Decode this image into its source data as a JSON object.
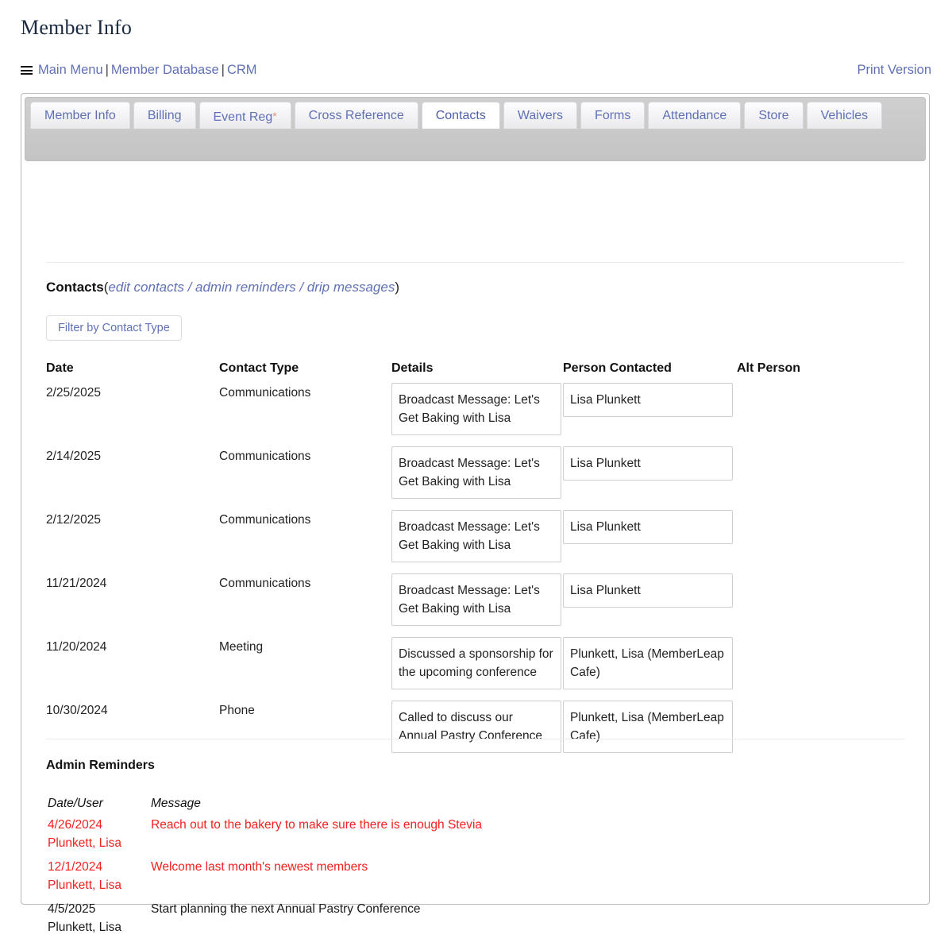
{
  "page": {
    "title": "Member Info"
  },
  "breadcrumb": {
    "menu_icon": "hamburger-icon",
    "items": [
      "Main Menu",
      "Member Database",
      "CRM"
    ],
    "separator": "|"
  },
  "header": {
    "print_link": "Print Version"
  },
  "tabs": [
    {
      "label": "Member Info",
      "active": false,
      "required_marker": ""
    },
    {
      "label": "Billing",
      "active": false,
      "required_marker": ""
    },
    {
      "label": "Event Reg",
      "active": false,
      "required_marker": "*"
    },
    {
      "label": "Cross Reference",
      "active": false,
      "required_marker": ""
    },
    {
      "label": "Contacts",
      "active": true,
      "required_marker": ""
    },
    {
      "label": "Waivers",
      "active": false,
      "required_marker": ""
    },
    {
      "label": "Forms",
      "active": false,
      "required_marker": ""
    },
    {
      "label": "Attendance",
      "active": false,
      "required_marker": ""
    },
    {
      "label": "Store",
      "active": false,
      "required_marker": ""
    },
    {
      "label": "Vehicles",
      "active": false,
      "required_marker": ""
    }
  ],
  "contacts_section": {
    "heading": "Contacts",
    "paren_open": "(",
    "paren_close": ")",
    "sublinks": "edit contacts / admin reminders / drip messages",
    "filter_button": "Filter by Contact Type",
    "columns": [
      "Date",
      "Contact Type",
      "Details",
      "Person Contacted",
      "Alt Person"
    ],
    "rows": [
      {
        "date": "2/25/2025",
        "type": "Communications",
        "details": "Broadcast Message: Let's Get Baking with Lisa",
        "person": "Lisa Plunkett",
        "alt": ""
      },
      {
        "date": "2/14/2025",
        "type": "Communications",
        "details": "Broadcast Message: Let's Get Baking with Lisa",
        "person": "Lisa Plunkett",
        "alt": ""
      },
      {
        "date": "2/12/2025",
        "type": "Communications",
        "details": "Broadcast Message: Let's Get Baking with Lisa",
        "person": "Lisa Plunkett",
        "alt": ""
      },
      {
        "date": "11/21/2024",
        "type": "Communications",
        "details": "Broadcast Message: Let's Get Baking with Lisa",
        "person": "Lisa Plunkett",
        "alt": ""
      },
      {
        "date": "11/20/2024",
        "type": "Meeting",
        "details": "Discussed a sponsorship for the upcoming conference",
        "person": "Plunkett, Lisa (MemberLeap Cafe)",
        "alt": ""
      },
      {
        "date": "10/30/2024",
        "type": "Phone",
        "details": "Called to discuss our Annual Pastry Conference",
        "person": "Plunkett, Lisa (MemberLeap Cafe)",
        "alt": ""
      }
    ]
  },
  "reminders_section": {
    "heading": "Admin Reminders",
    "columns": [
      "Date/User",
      "Message"
    ],
    "rows": [
      {
        "date": "4/26/2024",
        "user": "Plunkett, Lisa",
        "message": "Reach out to the bakery to make sure there is enough Stevia",
        "state": "overdue"
      },
      {
        "date": "12/1/2024",
        "user": "Plunkett, Lisa",
        "message": "Welcome last month's newest members",
        "state": "overdue"
      },
      {
        "date": "4/5/2025",
        "user": "Plunkett, Lisa",
        "message": "Start planning the next Annual Pastry Conference",
        "state": "normal"
      }
    ]
  },
  "colors": {
    "link": "#6071b5",
    "overdue_text": "#f41f1f",
    "required_marker": "#e79270",
    "tabstrip_bg": "#c8c8c8",
    "panel_border": "#b8b8bd"
  }
}
